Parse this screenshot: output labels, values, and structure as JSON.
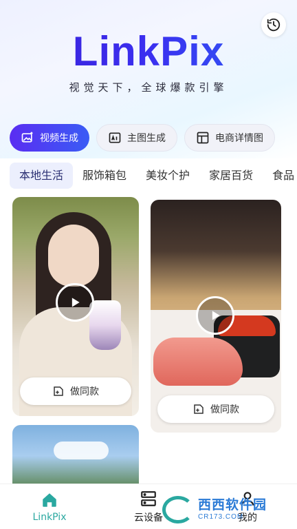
{
  "header": {
    "logo_text": "LinkPix",
    "slogan": "视觉天下，全球爆款引擎",
    "history_icon": "history-icon"
  },
  "modes": [
    {
      "label": "视频生成",
      "icon": "image-sparkle-icon",
      "active": true
    },
    {
      "label": "主图生成",
      "icon": "ai-image-icon",
      "active": false
    },
    {
      "label": "电商详情图",
      "icon": "layout-icon",
      "active": false
    }
  ],
  "categories": [
    {
      "label": "本地生活",
      "active": true
    },
    {
      "label": "服饰箱包",
      "active": false
    },
    {
      "label": "美妆个护",
      "active": false
    },
    {
      "label": "家居百货",
      "active": false
    },
    {
      "label": "食品",
      "active": false
    }
  ],
  "cards": [
    {
      "subject": "woman-with-drink",
      "same_label": "做同款"
    },
    {
      "subject": "sushi",
      "same_label": "做同款"
    },
    {
      "subject": "palm-trees-sky"
    }
  ],
  "tabbar": {
    "items": [
      {
        "label": "LinkPix",
        "icon": "home-icon",
        "active": true
      },
      {
        "label": "云设备",
        "icon": "server-icon",
        "active": false
      },
      {
        "label": "我的",
        "icon": "user-icon",
        "active": false
      }
    ]
  },
  "watermark": {
    "cn": "西西软件园",
    "en": "CR173.COM"
  },
  "colors": {
    "accent_gradient_start": "#5a2df2",
    "accent_gradient_end": "#3a5cf5",
    "tab_active": "#2aa8a0",
    "logo_purple": "#3a1fd6"
  }
}
